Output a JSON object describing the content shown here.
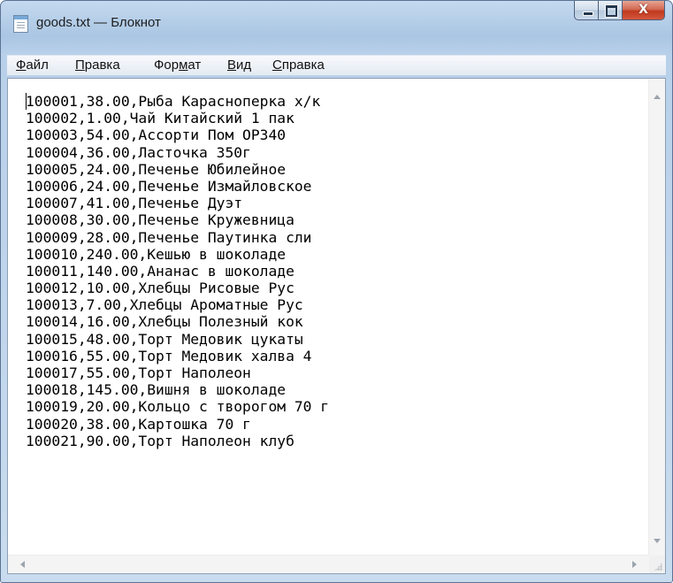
{
  "window": {
    "title": "goods.txt — Блокнот",
    "icons": {
      "app": "notepad-icon",
      "minimize": "minimize-icon",
      "maximize": "maximize-icon",
      "close": "close-icon"
    },
    "close_glyph": "X"
  },
  "menu": [
    {
      "id": "file",
      "label": "Файл",
      "accesskey_index": 0
    },
    {
      "id": "edit",
      "label": "Правка",
      "accesskey_index": 0
    },
    {
      "id": "format",
      "label": "Формат",
      "accesskey_index": 3
    },
    {
      "id": "view",
      "label": "Вид",
      "accesskey_index": 0
    },
    {
      "id": "help",
      "label": "Справка",
      "accesskey_index": 0
    }
  ],
  "document": {
    "lines": [
      "100001,38.00,Рыба Карасноперка х/к",
      "100002,1.00,Чай Китайский 1 пак",
      "100003,54.00,Ассорти Пом ОР340",
      "100004,36.00,Ласточка 350г",
      "100005,24.00,Печенье Юбилейное",
      "100006,24.00,Печенье Измайловское",
      "100007,41.00,Печенье Дуэт",
      "100008,30.00,Печенье Кружевница",
      "100009,28.00,Печенье Паутинка сли",
      "100010,240.00,Кешью в шоколаде",
      "100011,140.00,Ананас в шоколаде",
      "100012,10.00,Хлебцы Рисовые Рус",
      "100013,7.00,Хлебцы Ароматные Рус",
      "100014,16.00,Хлебцы Полезный кок",
      "100015,48.00,Торт Медовик цукаты",
      "100016,55.00,Торт Медовик халва 4",
      "100017,55.00,Торт Наполеон",
      "100018,145.00,Вишня в шоколаде",
      "100019,20.00,Кольцо с творогом 70 г",
      "100020,38.00,Картошка 70 г",
      "100021,90.00,Торт Наполеон клуб"
    ]
  },
  "colors": {
    "frame": "#aac6e3",
    "close_button": "#c0391f",
    "editor_background": "#ffffff",
    "text": "#000000"
  }
}
